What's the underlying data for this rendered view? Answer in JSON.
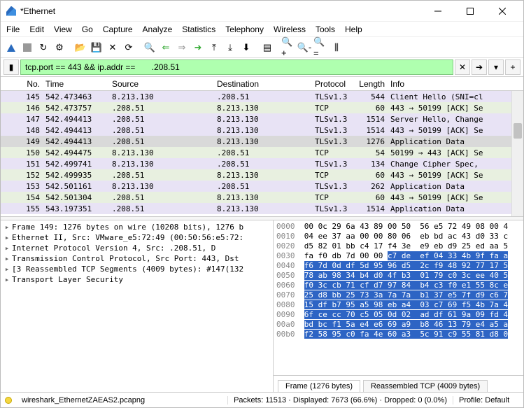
{
  "title": "*Ethernet",
  "menu": [
    "File",
    "Edit",
    "View",
    "Go",
    "Capture",
    "Analyze",
    "Statistics",
    "Telephony",
    "Wireless",
    "Tools",
    "Help"
  ],
  "filter": "tcp.port == 443 && ip.addr ==       .208.51",
  "columns": [
    "No.",
    "Time",
    "Source",
    "Destination",
    "Protocol",
    "Length",
    "Info"
  ],
  "rows": [
    {
      "no": "145",
      "tm": "542.473463",
      "sr": "      8.213.130",
      "ds": "      .208.51",
      "pr": "TLSv1.3",
      "ln": "544",
      "in": "Client Hello (SNI=cl",
      "cls": "tls"
    },
    {
      "no": "146",
      "tm": "542.473757",
      "sr": "     .208.51",
      "ds": "      8.213.130",
      "pr": "TCP",
      "ln": "60",
      "in": "443 → 50199 [ACK] Se",
      "cls": "tcp"
    },
    {
      "no": "147",
      "tm": "542.494413",
      "sr": "     .208.51",
      "ds": "      8.213.130",
      "pr": "TLSv1.3",
      "ln": "1514",
      "in": "Server Hello, Change",
      "cls": "tls"
    },
    {
      "no": "148",
      "tm": "542.494413",
      "sr": "     .208.51",
      "ds": "      8.213.130",
      "pr": "TLSv1.3",
      "ln": "1514",
      "in": "443 → 50199 [ACK] Se",
      "cls": "tls"
    },
    {
      "no": "149",
      "tm": "542.494413",
      "sr": "     .208.51",
      "ds": "      8.213.130",
      "pr": "TLSv1.3",
      "ln": "1276",
      "in": "Application Data",
      "cls": "sel"
    },
    {
      "no": "150",
      "tm": "542.494475",
      "sr": "      8.213.130",
      "ds": "      .208.51",
      "pr": "TCP",
      "ln": "54",
      "in": "50199 → 443 [ACK] Se",
      "cls": "tcp"
    },
    {
      "no": "151",
      "tm": "542.499741",
      "sr": "      8.213.130",
      "ds": "      .208.51",
      "pr": "TLSv1.3",
      "ln": "134",
      "in": "Change Cipher Spec,",
      "cls": "tls"
    },
    {
      "no": "152",
      "tm": "542.499935",
      "sr": "     .208.51",
      "ds": "      8.213.130",
      "pr": "TCP",
      "ln": "60",
      "in": "443 → 50199 [ACK] Se",
      "cls": "tcp"
    },
    {
      "no": "153",
      "tm": "542.501161",
      "sr": "      8.213.130",
      "ds": "      .208.51",
      "pr": "TLSv1.3",
      "ln": "262",
      "in": "Application Data",
      "cls": "tls"
    },
    {
      "no": "154",
      "tm": "542.501304",
      "sr": "     .208.51",
      "ds": "      8.213.130",
      "pr": "TCP",
      "ln": "60",
      "in": "443 → 50199 [ACK] Se",
      "cls": "tcp"
    },
    {
      "no": "155",
      "tm": "543.197351",
      "sr": "     .208.51",
      "ds": "      8.213.130",
      "pr": "TLSv1.3",
      "ln": "1514",
      "in": "Application Data",
      "cls": "tls"
    }
  ],
  "tree": [
    "Frame 149: 1276 bytes on wire (10208 bits), 1276 b",
    "Ethernet II, Src: VMware_e5:72:49 (00:50:56:e5:72:",
    "Internet Protocol Version 4, Src:      .208.51, D",
    "Transmission Control Protocol, Src Port: 443, Dst",
    "[3 Reassembled TCP Segments (4009 bytes): #147(132",
    "Transport Layer Security"
  ],
  "hex": [
    {
      "o": "0000",
      "d": "00 0c 29 6a 43 89 00 50  56 e5 72 49 08 00 4",
      "h": 0
    },
    {
      "o": "0010",
      "d": "04 ee 37 aa 00 00 80 06  eb bd ac 43 d0 33 c",
      "h": 0
    },
    {
      "o": "0020",
      "d": "d5 82 01 bb c4 17 f4 3e  e9 eb d9 25 ed aa 5",
      "h": 0
    },
    {
      "o": "0030",
      "d": "fa f0 db 7d 00 00 ",
      "d2": "c7 de  ef 04 33 4b 9f fa a",
      "h": 1
    },
    {
      "o": "0040",
      "d": "",
      "d2": "f6 7d 0d df 5d 95 96 d5  2c f9 48 92 77 17 5",
      "h": 2
    },
    {
      "o": "0050",
      "d": "",
      "d2": "78 ab 98 34 b4 d0 4f b3  01 79 c0 3c ee 40 5",
      "h": 2
    },
    {
      "o": "0060",
      "d": "",
      "d2": "f0 3c cb 71 cf d7 97 84  b4 c3 f0 e1 55 8c e",
      "h": 2
    },
    {
      "o": "0070",
      "d": "",
      "d2": "25 d8 bb 25 73 3a 7a 7a  b1 37 e5 7f d9 c6 7",
      "h": 2
    },
    {
      "o": "0080",
      "d": "",
      "d2": "15 df b7 95 a5 98 eb a4  03 c7 69 f5 4b 7a 4",
      "h": 2
    },
    {
      "o": "0090",
      "d": "",
      "d2": "6f ce cc 70 c5 05 0d 02  ad df 61 9a 09 fd 4",
      "h": 2
    },
    {
      "o": "00a0",
      "d": "",
      "d2": "bd bc f1 5a e4 e6 69 a9  b8 46 13 79 e4 a5 a",
      "h": 2
    },
    {
      "o": "00b0",
      "d": "",
      "d2": "f2 58 95 c0 fa 4e 60 a3  5c 91 c9 55 81 d8 0",
      "h": 2
    }
  ],
  "hextabs": {
    "frame": "Frame (1276 bytes)",
    "reasm": "Reassembled TCP (4009 bytes)"
  },
  "status": {
    "file": "wireshark_EthernetZAEAS2.pcapng",
    "pkts": "Packets: 11513 · Displayed: 7673 (66.6%) · Dropped: 0 (0.0%)",
    "profile": "Profile: Default"
  }
}
